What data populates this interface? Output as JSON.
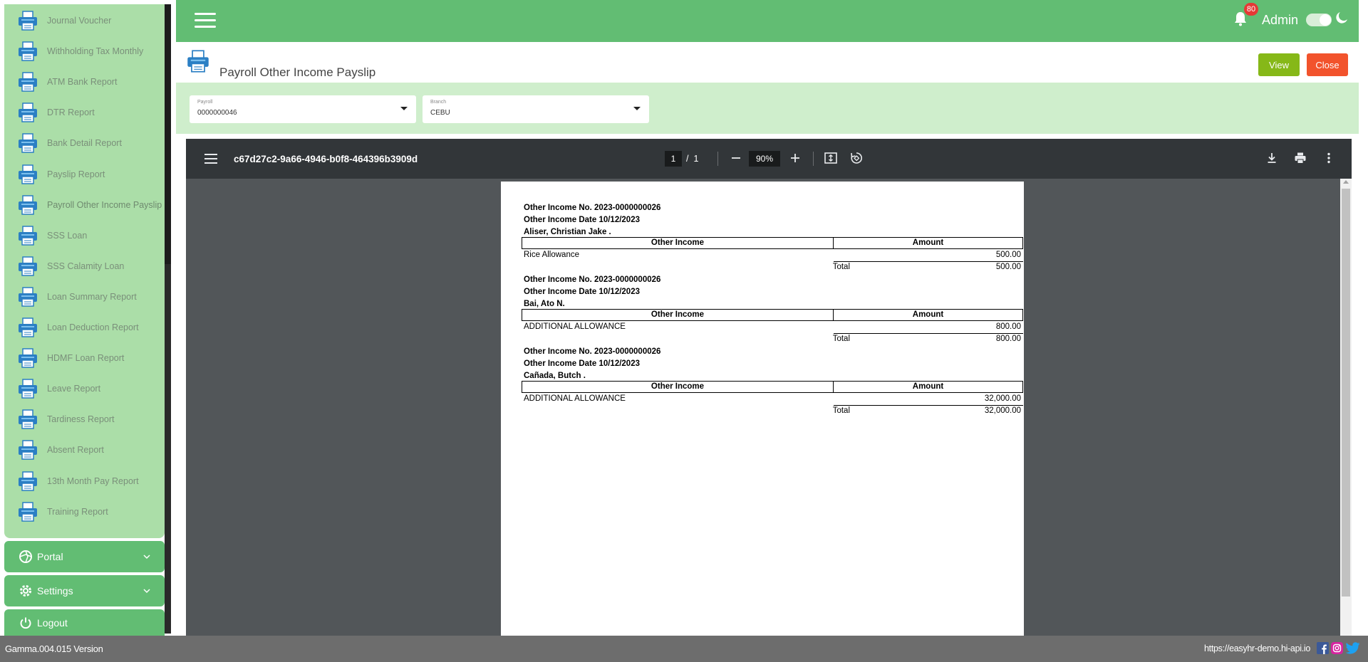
{
  "sidebar": {
    "items": [
      {
        "label": "Journal Voucher"
      },
      {
        "label": "Withholding Tax Monthly"
      },
      {
        "label": "ATM Bank Report"
      },
      {
        "label": "DTR Report"
      },
      {
        "label": "Bank Detail Report"
      },
      {
        "label": "Payslip Report"
      },
      {
        "label": "Payroll Other Income Payslip"
      },
      {
        "label": "SSS Loan"
      },
      {
        "label": "SSS Calamity Loan"
      },
      {
        "label": "Loan Summary Report"
      },
      {
        "label": "Loan Deduction Report"
      },
      {
        "label": "HDMF Loan Report"
      },
      {
        "label": "Leave Report"
      },
      {
        "label": "Tardiness Report"
      },
      {
        "label": "Absent Report"
      },
      {
        "label": "13th Month Pay Report"
      },
      {
        "label": "Training Report"
      }
    ],
    "portal_label": "Portal",
    "settings_label": "Settings",
    "logout_label": "Logout"
  },
  "header": {
    "notification_count": "80",
    "user_name": "Admin"
  },
  "page": {
    "title": "Payroll Other Income Payslip",
    "view_label": "View",
    "close_label": "Close"
  },
  "filters": {
    "payroll_label": "Payroll",
    "payroll_value": "0000000046",
    "branch_label": "Branch",
    "branch_value": "CEBU"
  },
  "viewer": {
    "filename": "c67d27c2-9a66-4946-b0f8-464396b3909d",
    "current_page": "1",
    "page_sep": "/",
    "total_pages": "1",
    "zoom": "90%"
  },
  "document": {
    "col_income": "Other Income",
    "col_amount": "Amount",
    "total_label": "Total",
    "records": [
      {
        "no_line": "Other Income No. 2023-0000000026",
        "date_line": "Other Income Date 10/12/2023",
        "employee": "Aliser, Christian Jake .",
        "item": "Rice Allowance",
        "amount": "500.00",
        "total": "500.00"
      },
      {
        "no_line": "Other Income No. 2023-0000000026",
        "date_line": "Other Income Date 10/12/2023",
        "employee": "Bai, Ato N.",
        "item": "ADDITIONAL ALLOWANCE",
        "amount": "800.00",
        "total": "800.00"
      },
      {
        "no_line": "Other Income No. 2023-0000000026",
        "date_line": "Other Income Date 10/12/2023",
        "employee": "Cañada, Butch .",
        "item": "ADDITIONAL ALLOWANCE",
        "amount": "32,000.00",
        "total": "32,000.00"
      }
    ]
  },
  "footer": {
    "version": "Gamma.004.015 Version",
    "url": "https://easyhr-demo.hi-api.io"
  },
  "colors": {
    "primary_green": "#62bd73",
    "sidebar_green": "#abdea8",
    "filter_green": "#cfeecc",
    "view_button": "#86b818",
    "close_button": "#f2532c",
    "badge_red": "#e53935"
  }
}
